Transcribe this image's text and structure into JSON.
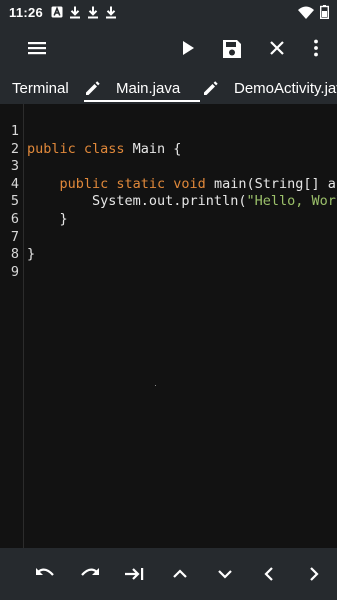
{
  "status_bar": {
    "time": "11:26",
    "left_icons": [
      "a-box-icon",
      "download-icon",
      "download-icon",
      "download-icon"
    ],
    "right_icons": [
      "wifi-icon",
      "battery-icon"
    ]
  },
  "toolbar": {
    "icons": [
      "menu-icon",
      "play-icon",
      "save-icon",
      "close-icon",
      "more-vert-icon"
    ]
  },
  "tabs": [
    {
      "label": "Terminal",
      "active": false
    },
    {
      "label": "Main.java",
      "active": true
    },
    {
      "label": "DemoActivity.java",
      "active": false
    }
  ],
  "editor": {
    "line_numbers": [
      "1",
      "2",
      "3",
      "4",
      "5",
      "6",
      "7",
      "8",
      "9"
    ],
    "lines": [
      [],
      [
        {
          "t": "public class ",
          "c": "kw"
        },
        {
          "t": "Main {",
          "c": ""
        }
      ],
      [],
      [
        {
          "t": "    public static void ",
          "c": "kw"
        },
        {
          "t": "main(String[] args) {",
          "c": ""
        }
      ],
      [
        {
          "t": "        System.out.println(",
          "c": ""
        },
        {
          "t": "\"Hello, World!\"",
          "c": "str"
        },
        {
          "t": ");",
          "c": ""
        }
      ],
      [
        {
          "t": "    }",
          "c": ""
        }
      ],
      [],
      [
        {
          "t": "}",
          "c": ""
        }
      ],
      []
    ]
  },
  "bottom_toolbar": {
    "icons": [
      "undo-icon",
      "redo-icon",
      "tab-indent-icon",
      "arrow-up-icon",
      "arrow-down-icon",
      "arrow-left-icon",
      "arrow-right-icon"
    ]
  },
  "colors": {
    "keyword": "#e0883a",
    "string": "#9bc06a",
    "bar_bg": "#262a2e",
    "editor_bg": "#121212"
  }
}
